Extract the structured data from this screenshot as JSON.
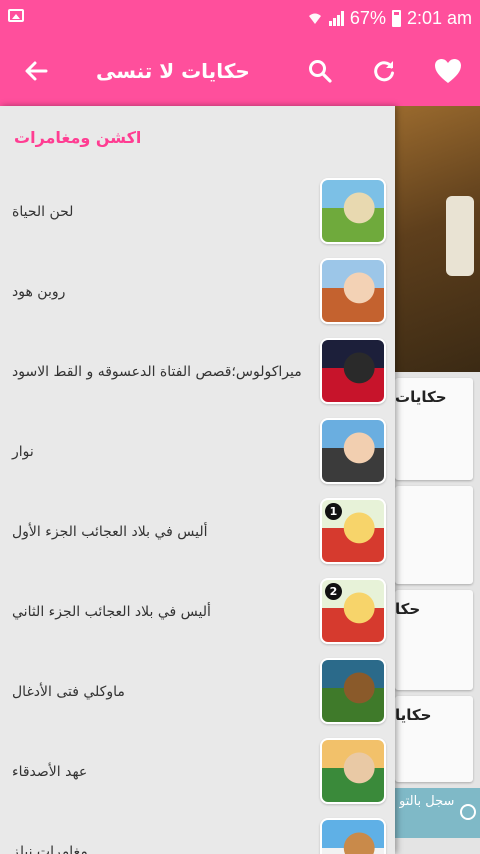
{
  "status_bar": {
    "battery": "67%",
    "time": "2:01 am"
  },
  "app_bar": {
    "title": "حكايات لا تنسى",
    "icons": [
      "arrow-back-icon",
      "search-icon",
      "refresh-icon",
      "heart-icon"
    ]
  },
  "drawer": {
    "section_title": "اكشن ومغامرات",
    "items": [
      {
        "label": "لحن الحياة",
        "thumb_colors": [
          "#7cc0e6",
          "#6faa3c",
          "#e8d9b0"
        ]
      },
      {
        "label": "روبن هود",
        "thumb_colors": [
          "#9cc6e8",
          "#c4622f",
          "#f3d2b5"
        ]
      },
      {
        "label": "ميراكولوس؛قصص الفتاة الدعسوقه و القط الاسود",
        "thumb_colors": [
          "#1c1f3a",
          "#c7142b",
          "#2a2a2a"
        ]
      },
      {
        "label": "نوار",
        "thumb_colors": [
          "#6aaee0",
          "#3b3b3b",
          "#f2cfb0"
        ]
      },
      {
        "label": "أليس في بلاد العجائب الجزء الأول",
        "badge": "1",
        "thumb_colors": [
          "#e7f2d8",
          "#d63a2e",
          "#f7d46a"
        ]
      },
      {
        "label": "أليس في بلاد العجائب الجزء الثاني",
        "badge": "2",
        "thumb_colors": [
          "#e7f2d8",
          "#d63a2e",
          "#f7d46a"
        ]
      },
      {
        "label": "ماوكلي فتى الأدغال",
        "thumb_colors": [
          "#2b6a8a",
          "#3f7a2a",
          "#8a5a2a"
        ]
      },
      {
        "label": "عهد الأصدقاء",
        "thumb_colors": [
          "#f2c16a",
          "#3a8a3a",
          "#e9c9a5"
        ]
      },
      {
        "label": "مغامرات نيلز",
        "thumb_colors": [
          "#5fb0e6",
          "#f2f2f2",
          "#c98a4a"
        ]
      }
    ]
  },
  "background": {
    "cards": [
      {
        "title": "حكايات"
      },
      {
        "title": ""
      },
      {
        "title": "حكا"
      },
      {
        "title": "حكايا"
      }
    ],
    "ad_text": "سجل بالتو"
  }
}
